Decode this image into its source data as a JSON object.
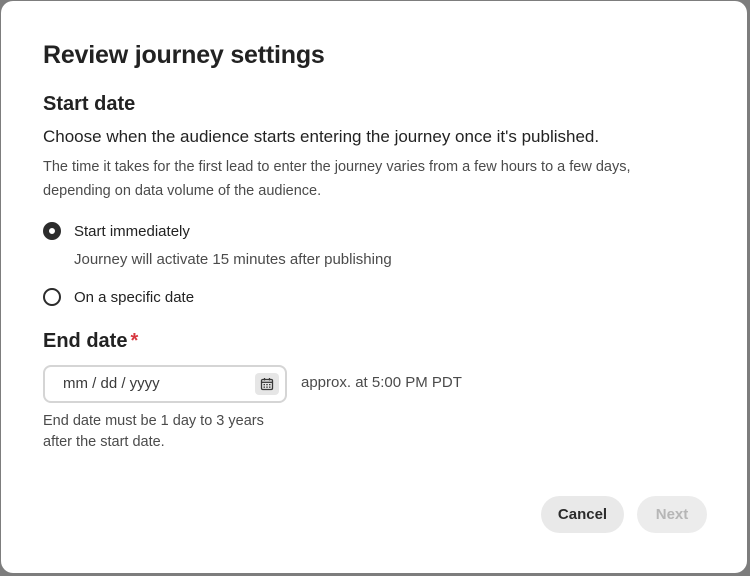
{
  "dialog": {
    "title": "Review journey settings",
    "start_date": {
      "heading": "Start date",
      "lead": "Choose when the audience starts entering the journey once it's published.",
      "description": "The time it takes for the first lead to enter the journey varies from a few hours to a few days, depending on data volume of the audience.",
      "options": [
        {
          "label": "Start immediately",
          "help": "Journey will activate 15 minutes after publishing",
          "selected": true
        },
        {
          "label": "On a specific date",
          "selected": false
        }
      ]
    },
    "end_date": {
      "heading": "End date",
      "required_marker": "*",
      "input": {
        "placeholder": "mm / dd / yyyy",
        "value": ""
      },
      "calendar_icon": "calendar-icon",
      "approx_time": "approx. at 5:00 PM PDT",
      "help": "End date must be 1 day to 3 years after the start date."
    },
    "buttons": {
      "cancel": "Cancel",
      "next": "Next",
      "next_disabled": true
    }
  },
  "colors": {
    "overlay": "#7d7d7d",
    "text_primary": "#222222",
    "text_secondary": "#4b4b4b",
    "required": "#d7373f",
    "button_bg": "#e9e9e9",
    "disabled_text": "#b6b6b6"
  }
}
